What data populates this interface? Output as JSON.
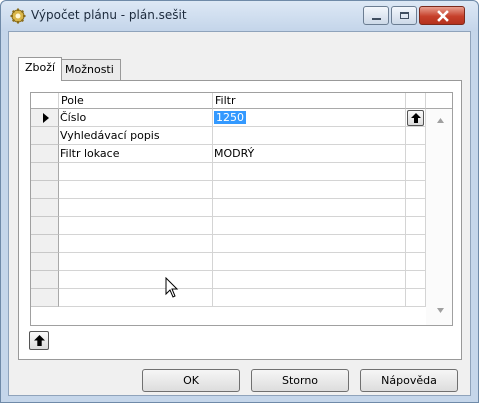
{
  "window": {
    "title": "Výpočet plánu - plán.sešit"
  },
  "tabs": [
    {
      "label": "Zboží",
      "active": true
    },
    {
      "label": "Možnosti",
      "active": false
    }
  ],
  "grid": {
    "headers": [
      "Pole",
      "Filtr"
    ],
    "rows": [
      {
        "field": "Číslo",
        "filter": "1250",
        "current": true
      },
      {
        "field": "Vyhledávací popis",
        "filter": ""
      },
      {
        "field": "Filtr lokace",
        "filter": "MODRÝ"
      }
    ],
    "empty_rows": 7
  },
  "buttons": {
    "ok": "OK",
    "cancel": "Storno",
    "help": "Nápověda"
  },
  "icons": {
    "app": "gear-icon",
    "row_marker": "triangle-right-icon",
    "assist": "arrow-up-icon"
  },
  "colors": {
    "selection": "#3399ff",
    "close_button": "#c6402b",
    "frame": "#c5d6ea"
  }
}
